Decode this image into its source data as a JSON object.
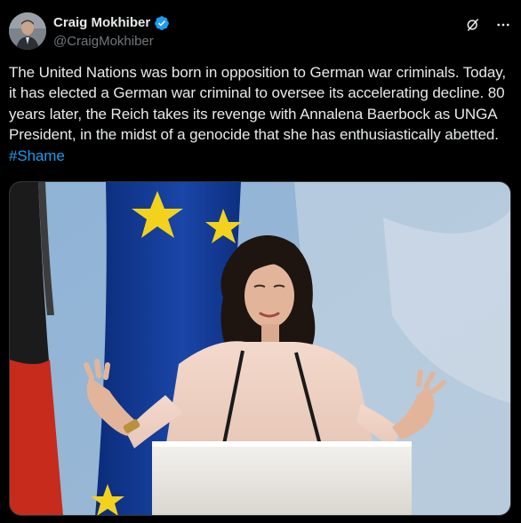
{
  "author": {
    "display_name": "Craig Mokhiber",
    "handle": "@CraigMokhiber",
    "verified": true
  },
  "icons": {
    "verified": "verified-badge-icon",
    "grok": "grok-icon",
    "more": "more-options-icon"
  },
  "tweet": {
    "text": "The United Nations was born in opposition to German war criminals. Today, it has elected a German war criminal to oversee its accelerating decline. 80 years later, the Reich takes its revenge with Annalena Baerbock as UNGA President, in the midst of a genocide that she has enthusiastically abetted.",
    "hashtag": "#Shame"
  },
  "colors": {
    "background": "#000000",
    "text": "#e7e9ea",
    "secondary_text": "#71767b",
    "link": "#1d9bf0",
    "verified": "#1d9bf0"
  }
}
